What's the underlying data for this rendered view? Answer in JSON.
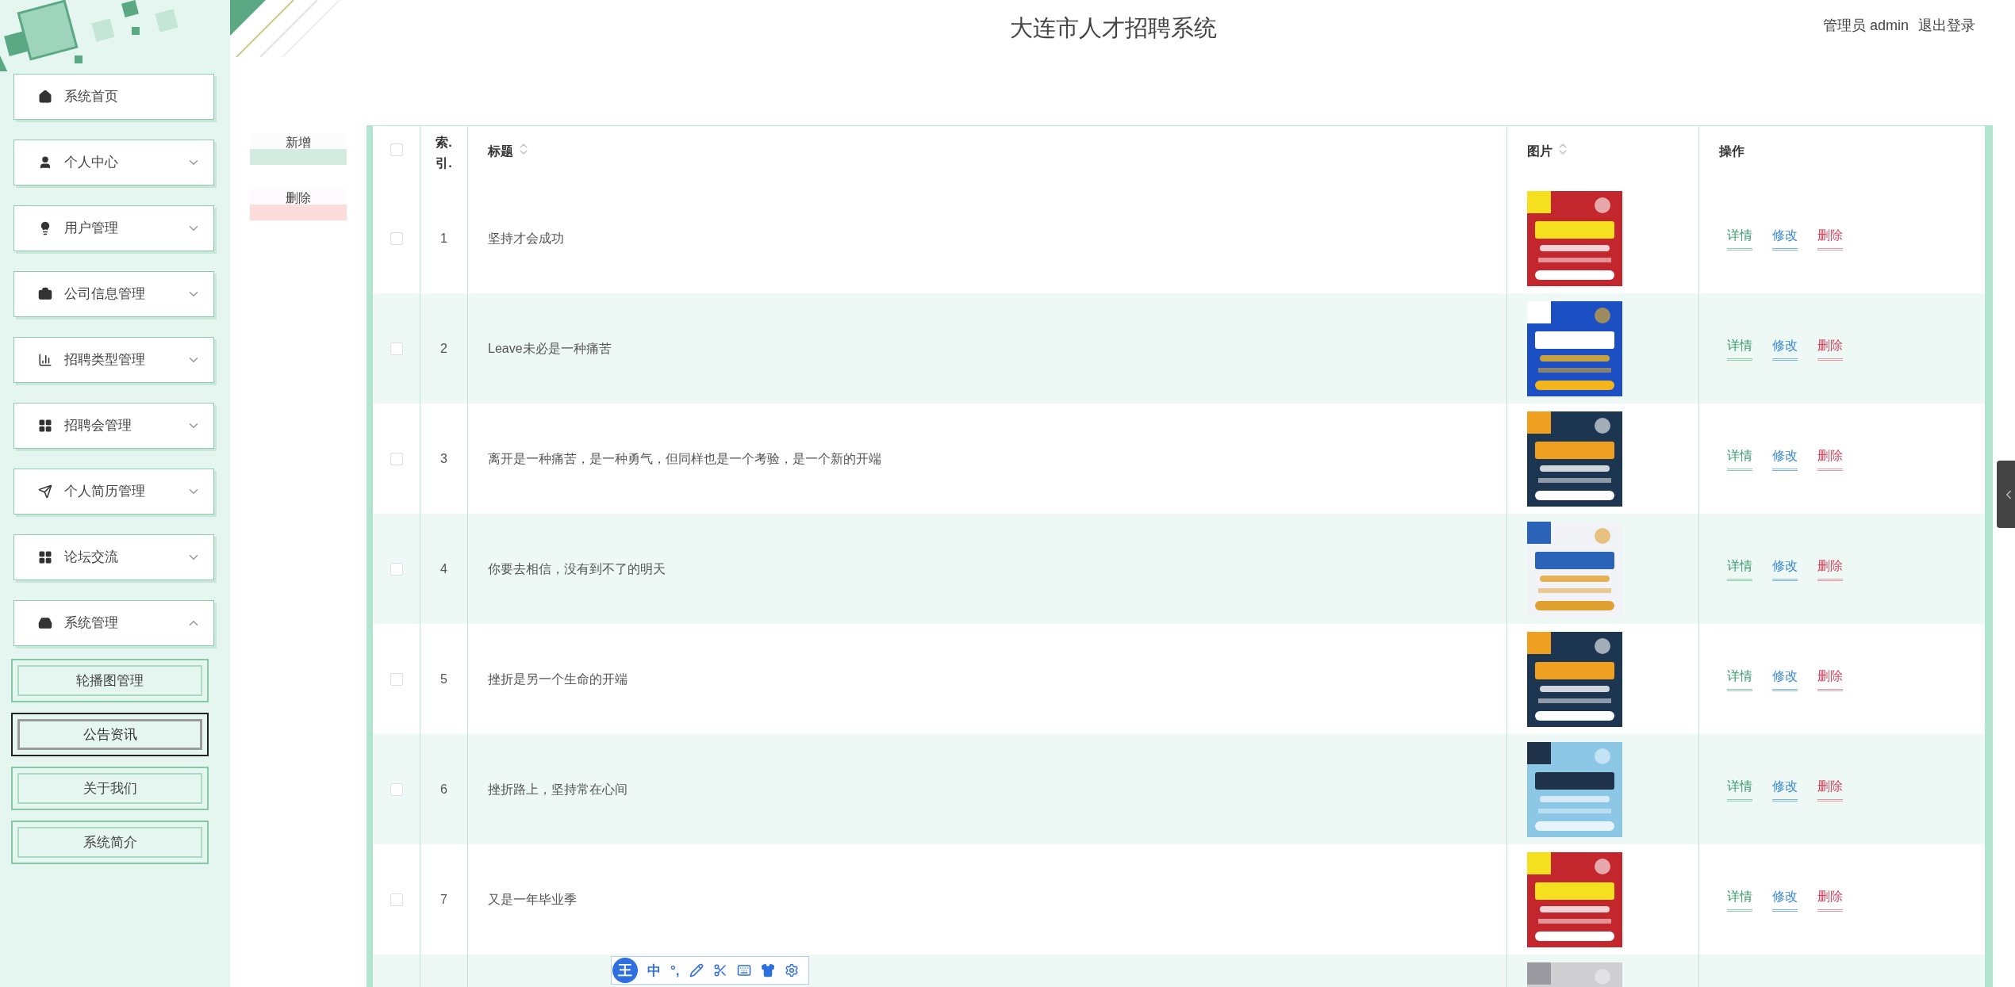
{
  "header": {
    "title": "大连市人才招聘系统",
    "user": "管理员 admin",
    "logout": "退出登录"
  },
  "sidebar": {
    "items": [
      {
        "label": "系统首页",
        "kind": "link"
      },
      {
        "label": "个人中心",
        "kind": "menu",
        "expanded": false
      },
      {
        "label": "用户管理",
        "kind": "menu",
        "expanded": false
      },
      {
        "label": "公司信息管理",
        "kind": "menu",
        "expanded": false
      },
      {
        "label": "招聘类型管理",
        "kind": "menu",
        "expanded": false
      },
      {
        "label": "招聘会管理",
        "kind": "menu",
        "expanded": false
      },
      {
        "label": "个人简历管理",
        "kind": "menu",
        "expanded": false
      },
      {
        "label": "论坛交流",
        "kind": "menu",
        "expanded": false
      },
      {
        "label": "系统管理",
        "kind": "menu",
        "expanded": true,
        "children": [
          {
            "label": "轮播图管理",
            "selected": false
          },
          {
            "label": "公告资讯",
            "selected": true
          },
          {
            "label": "关于我们",
            "selected": false
          },
          {
            "label": "系统简介",
            "selected": false
          }
        ]
      }
    ]
  },
  "actions": [
    {
      "label": "新增",
      "kind": "add"
    },
    {
      "label": "删除",
      "kind": "delete"
    }
  ],
  "table": {
    "select_all_checked": false,
    "columns": [
      {
        "label": "索.引.",
        "sortable": false
      },
      {
        "label": "标题",
        "sortable": true
      },
      {
        "label": "图片",
        "sortable": true
      },
      {
        "label": "操作",
        "sortable": false
      }
    ],
    "rows": [
      {
        "checked": false,
        "index": "1",
        "title": "坚持才会成功",
        "image": {
          "kind": "picture"
        },
        "actions": [
          "详情",
          "修改",
          "删除"
        ]
      },
      {
        "checked": false,
        "index": "2",
        "title": "Leave未必是一种痛苦",
        "image": {
          "kind": "picture"
        },
        "actions": [
          "详情",
          "修改",
          "删除"
        ]
      },
      {
        "checked": false,
        "index": "3",
        "title": "离开是一种痛苦，是一种勇气，但同样也是一个考验，是一个新的开端",
        "image": {
          "kind": "picture"
        },
        "actions": [
          "详情",
          "修改",
          "删除"
        ]
      },
      {
        "checked": false,
        "index": "4",
        "title": "你要去相信，没有到不了的明天",
        "image": {
          "kind": "picture"
        },
        "actions": [
          "详情",
          "修改",
          "删除"
        ]
      },
      {
        "checked": false,
        "index": "5",
        "title": "挫折是另一个生命的开端",
        "image": {
          "kind": "picture"
        },
        "actions": [
          "详情",
          "修改",
          "删除"
        ]
      },
      {
        "checked": false,
        "index": "6",
        "title": "挫折路上，坚持常在心间",
        "image": {
          "kind": "picture"
        },
        "actions": [
          "详情",
          "修改",
          "删除"
        ]
      },
      {
        "checked": false,
        "index": "7",
        "title": "又是一年毕业季",
        "image": {
          "kind": "picture"
        },
        "actions": [
          "详情",
          "修改",
          "删除"
        ]
      },
      {
        "image": {
          "kind": "picture"
        }
      }
    ]
  },
  "ime_toolbar": {
    "items": [
      {
        "kind": "logo",
        "text": "王"
      },
      {
        "kind": "text",
        "text": "中"
      },
      {
        "kind": "text",
        "text": "°,"
      },
      {
        "kind": "pen"
      },
      {
        "kind": "scissors"
      },
      {
        "kind": "keyboard"
      },
      {
        "kind": "shirt"
      },
      {
        "kind": "settings"
      }
    ]
  }
}
